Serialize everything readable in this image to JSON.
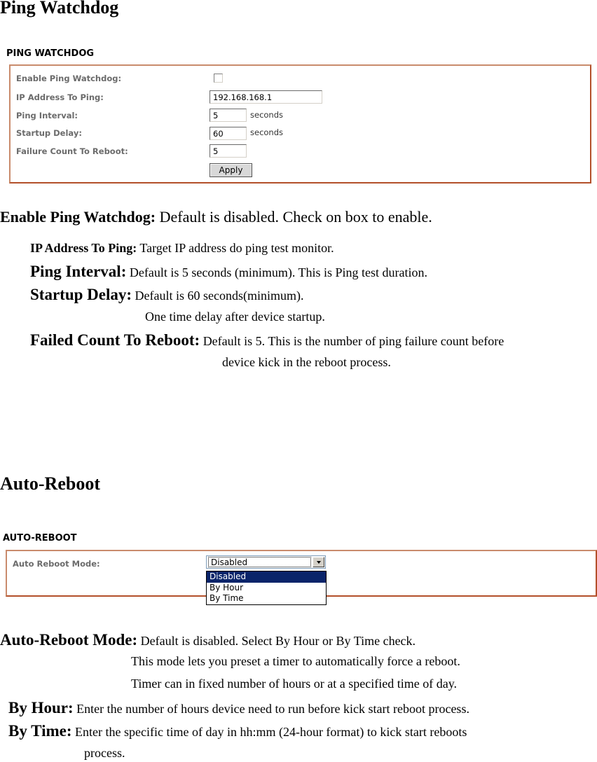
{
  "ping_section": {
    "heading": "Ping Watchdog",
    "panel_title": "PING WATCHDOG",
    "fields": {
      "enable_label": "Enable Ping Watchdog:",
      "enable_checked": false,
      "ip_label": "IP Address To Ping:",
      "ip_value": "192.168.168.1",
      "interval_label": "Ping Interval:",
      "interval_value": "5",
      "interval_unit": "seconds",
      "startup_label": "Startup Delay:",
      "startup_value": "60",
      "startup_unit": "seconds",
      "failure_label": "Failure Count To Reboot:",
      "failure_value": "5",
      "apply_label": "Apply"
    },
    "descriptions": {
      "enable_term": "Enable Ping Watchdog:",
      "enable_text": " Default is disabled. Check on box to enable.",
      "ip_term": "IP Address To Ping:",
      "ip_text": " Target IP address do ping test monitor.",
      "interval_term": "Ping Interval:",
      "interval_text": " Default is 5 seconds (minimum). This is Ping test duration.",
      "startup_term": "Startup Delay:",
      "startup_text": " Default is 60 seconds(minimum).",
      "startup_text2": "One time delay after device startup.",
      "failed_term": "Failed Count To Reboot:",
      "failed_text": " Default is 5. This is the number of ping failure count before",
      "failed_text2": "device kick in the reboot process."
    }
  },
  "reboot_section": {
    "heading": "Auto-Reboot",
    "panel_title": "AUTO-REBOOT",
    "mode_label": "Auto Reboot Mode:",
    "mode_selected": "Disabled",
    "mode_options": [
      "Disabled",
      "By Hour",
      "By Time"
    ],
    "descriptions": {
      "mode_term": "Auto-Reboot Mode:",
      "mode_text": " Default is disabled. Select By Hour or By Time check.",
      "mode_text2": "This mode lets you preset a timer to automatically force a reboot.",
      "mode_text3": "Timer can in fixed number of hours or at a specified time of day.",
      "hour_term": "By Hour:",
      "hour_text": " Enter the number of hours device need to run before kick start reboot process.",
      "time_term": "By Time:",
      "time_text": " Enter the specific time of day in hh:mm (24-hour format) to kick start reboots",
      "time_text2": "process."
    }
  }
}
